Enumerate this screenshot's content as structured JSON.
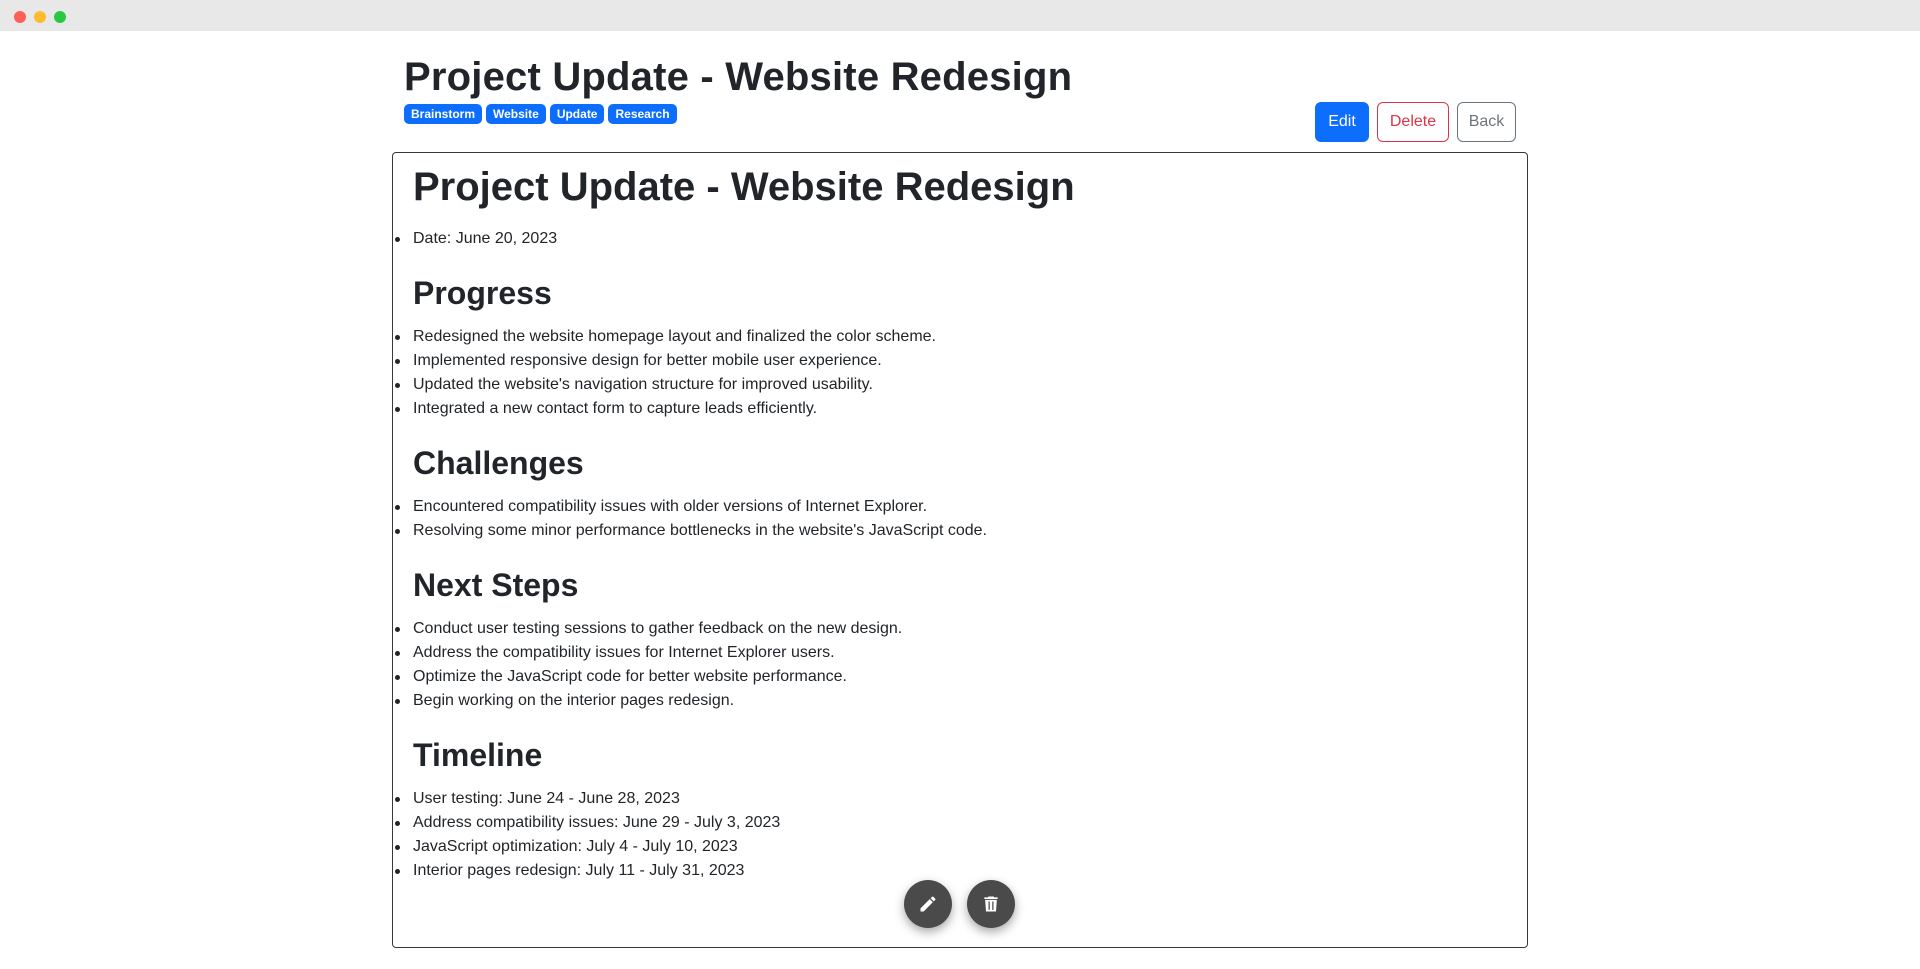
{
  "header": {
    "title": "Project Update - Website Redesign",
    "tags": [
      "Brainstorm",
      "Website",
      "Update",
      "Research"
    ],
    "actions": {
      "edit": "Edit",
      "delete": "Delete",
      "back": "Back"
    }
  },
  "note": {
    "title": "Project Update - Website Redesign",
    "intro": [
      "Date: June 20, 2023"
    ],
    "sections": [
      {
        "heading": "Progress",
        "items": [
          "Redesigned the website homepage layout and finalized the color scheme.",
          "Implemented responsive design for better mobile user experience.",
          "Updated the website's navigation structure for improved usability.",
          "Integrated a new contact form to capture leads efficiently."
        ]
      },
      {
        "heading": "Challenges",
        "items": [
          "Encountered compatibility issues with older versions of Internet Explorer.",
          "Resolving some minor performance bottlenecks in the website's JavaScript code."
        ]
      },
      {
        "heading": "Next Steps",
        "items": [
          "Conduct user testing sessions to gather feedback on the new design.",
          "Address the compatibility issues for Internet Explorer users.",
          "Optimize the JavaScript code for better website performance.",
          "Begin working on the interior pages redesign."
        ]
      },
      {
        "heading": "Timeline",
        "items": [
          "User testing: June 24 - June 28, 2023",
          "Address compatibility issues: June 29 - July 3, 2023",
          "JavaScript optimization: July 4 - July 10, 2023",
          "Interior pages redesign: July 11 - July 31, 2023"
        ]
      }
    ]
  },
  "fab": {
    "edit_icon": "pencil-icon",
    "delete_icon": "trash-icon"
  },
  "colors": {
    "primary": "#0d6efd",
    "danger": "#dc3545",
    "secondary": "#6c757d",
    "fab": "#4a4a4a"
  }
}
